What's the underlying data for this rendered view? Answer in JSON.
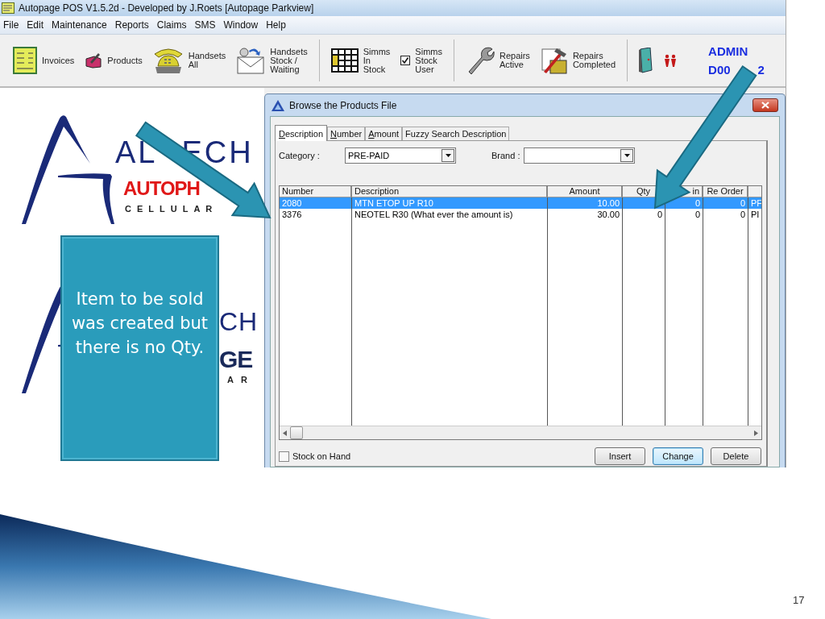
{
  "window": {
    "title": "Autopage POS V1.5.2d - Developed by J.Roets [Autopage Parkview]"
  },
  "menu": [
    "File",
    "Edit",
    "Maintenance",
    "Reports",
    "Claims",
    "SMS",
    "Window",
    "Help"
  ],
  "toolbar": [
    {
      "kind": "tool",
      "lines": [
        "Invoices"
      ]
    },
    {
      "kind": "tool",
      "lines": [
        "Products"
      ]
    },
    {
      "kind": "tool",
      "lines": [
        "Handsets",
        "All"
      ]
    },
    {
      "kind": "tool",
      "lines": [
        "Handsets",
        "Stock /",
        "Waiting"
      ]
    },
    {
      "kind": "separator"
    },
    {
      "kind": "tool",
      "lines": [
        "Simms",
        "In",
        "Stock"
      ]
    },
    {
      "kind": "tool",
      "lines": [
        "Simms",
        "Stock",
        "User"
      ]
    },
    {
      "kind": "separator"
    },
    {
      "kind": "tool",
      "lines": [
        "Repairs",
        "Active"
      ]
    },
    {
      "kind": "tool",
      "lines": [
        "Repairs",
        "Completed"
      ]
    },
    {
      "kind": "separator"
    },
    {
      "kind": "tool"
    },
    {
      "kind": "tool"
    }
  ],
  "user": {
    "name": "ADMIN",
    "code_parts": [
      "D00",
      "2"
    ]
  },
  "logos": [
    {
      "top_parts": [
        "AL",
        "ECH"
      ],
      "brand": "AUTOPH",
      "tagline": "CELLULAR"
    },
    {
      "top_parts": [
        "CH"
      ],
      "brand": "GE",
      "tagline": "AR"
    }
  ],
  "dialog": {
    "title": "Browse the Products File",
    "tabs": [
      {
        "label": "Description",
        "selected": true,
        "underlined": true
      },
      {
        "label": "Number",
        "selected": false,
        "underlined": true
      },
      {
        "label": "Amount",
        "selected": false,
        "underlined": true
      },
      {
        "label": "Fuzzy Search Description",
        "selected": false,
        "underlined": false
      }
    ],
    "category": {
      "label": "Category :",
      "value": "PRE-PAID"
    },
    "brand": {
      "label": "Brand :"
    },
    "columns": [
      "Number",
      "Description",
      "Amount",
      "Qty",
      "in",
      "Re Order"
    ],
    "rows": [
      {
        "selected": true,
        "number": "2080",
        "description": "MTN ETOP UP R10",
        "amount": "10.00",
        "min": "0",
        "re_order": "0",
        "column_7": "PF"
      },
      {
        "selected": false,
        "number": "3376",
        "description": "NEOTEL R30 (What ever the amount is)",
        "amount": "30.00",
        "qty": "0",
        "min": "0",
        "re_order": "0",
        "column_7": "PI"
      }
    ],
    "stock_on_hand": {
      "label": "Stock on Hand",
      "checked": false
    },
    "buttons": [
      {
        "label": "Insert",
        "focused": false
      },
      {
        "label": "Change",
        "focused": true
      },
      {
        "label": "Delete",
        "focused": false
      }
    ]
  },
  "callout": {
    "text": "Item to be sold was created but there is no Qty."
  },
  "slide_number": "17"
}
